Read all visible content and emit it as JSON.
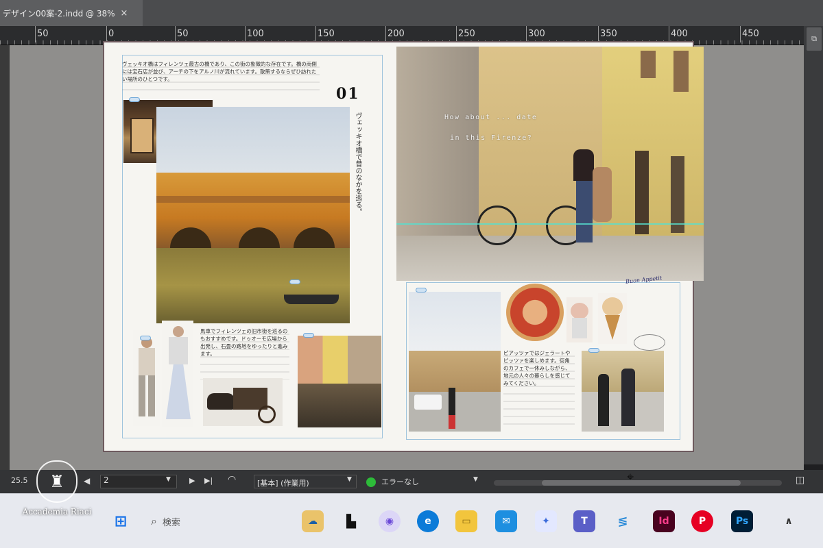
{
  "document_tab": {
    "title": "デザイン00案-2.indd @ 38%",
    "close_glyph": "×"
  },
  "ruler": {
    "ticks": [
      "50",
      "0",
      "50",
      "100",
      "150",
      "200",
      "250",
      "300",
      "350",
      "400",
      "450"
    ]
  },
  "spread": {
    "page_number_mark": "01",
    "vertical_caption": "ヴェッキオ橋で昔のなかを巡る。",
    "intro_text": "ヴェッキオ橋はフィレンツェ最古の橋であり、この街の象徴的な存在です。橋の両側には宝石店が並び、アーチの下をアルノ川が流れています。散策するならぜひ訪れたい場所のひとつです。",
    "overlay_caption_line1": "How about ... date",
    "overlay_caption_line2": "in this Firenze?",
    "small_caption": "Buon Appetit",
    "block_text_left": "馬車でフィレンツェの旧市街を巡るのもおすすめです。ドゥオーモ広場から出発し、石畳の路地をゆったりと進みます。",
    "block_text_right": "ピアッツァではジェラートやピッツァを楽しめます。街角のカフェで一休みしながら、地元の人々の暮らしを感じてみてください。"
  },
  "statusbar": {
    "zoom": "25.5",
    "page": "2",
    "style": "[基本] (作業用)",
    "error_status": "エラーなし"
  },
  "taskbar": {
    "search_placeholder": "検索",
    "apps": [
      "windows-start",
      "search",
      "widgets",
      "file-explorer-alt",
      "copilot",
      "edge",
      "file-explorer",
      "mail",
      "photos",
      "teams",
      "remote",
      "indesign",
      "pinterest",
      "photoshop"
    ]
  },
  "watermark": {
    "text": "Accademia Riaci"
  },
  "colors": {
    "indesign": "#49021f",
    "photoshop": "#001e36",
    "pinterest": "#e60023",
    "edge": "#0c7bd8",
    "status_ok": "#2dbb39"
  }
}
